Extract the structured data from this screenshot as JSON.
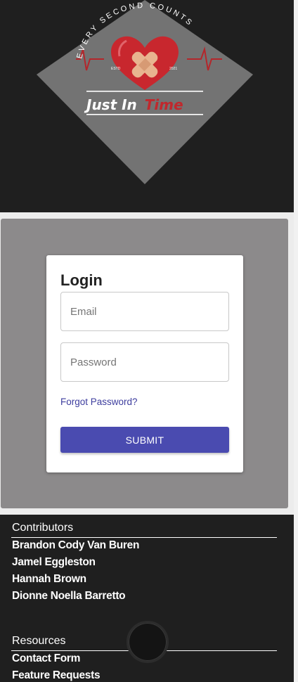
{
  "header": {
    "logo": {
      "tagline": "EVERY SECOND COUNTS",
      "estd_label": "ESTD",
      "estd_year": "2021",
      "wordmark_primary": "Just In",
      "wordmark_accent": "Time",
      "accent_color": "#c0282d"
    }
  },
  "login": {
    "title": "Login",
    "email_placeholder": "Email",
    "password_placeholder": "Password",
    "forgot_password": "Forgot Password?",
    "submit_label": "SUBMIT",
    "button_color": "#4a4bb0"
  },
  "footer": {
    "contributors_heading": "Contributors",
    "contributors": [
      "Brandon Cody Van Buren",
      "Jamel Eggleston",
      "Hannah Brown",
      "Dionne Noella Barretto"
    ],
    "resources_heading": "Resources",
    "resources": [
      "Contact Form",
      "Feature Requests"
    ]
  }
}
